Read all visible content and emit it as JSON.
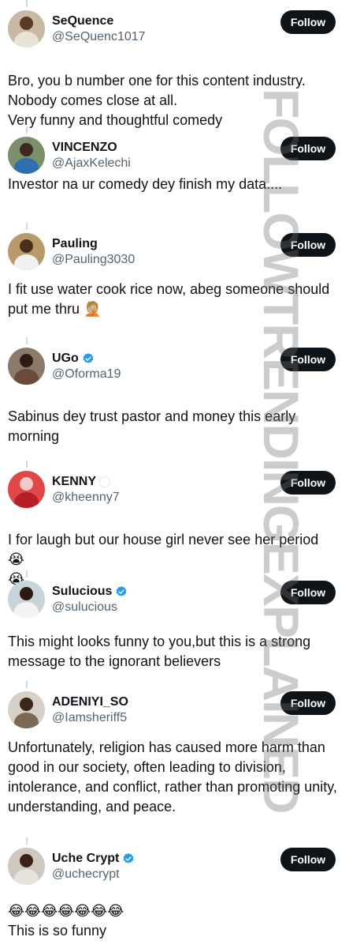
{
  "follow_label": "Follow",
  "verified_color": "#1d9bf0",
  "button_color": "#0f1419",
  "watermark": "FOLLOWTRENDINGEXPLAINED",
  "replies": [
    {
      "name": "SeQuence",
      "handle": "@SeQuenc1017",
      "verified": false,
      "badge": "",
      "text": "Bro, you b number one for this content industry.\nNobody comes close at all.\nVery funny and thoughtful comedy"
    },
    {
      "name": "VINCENZO",
      "handle": "@AjaxKelechi",
      "verified": false,
      "badge": "",
      "text": "Investor na ur comedy dey finish my data...."
    },
    {
      "name": "Pauling",
      "handle": "@Pauling3030",
      "verified": false,
      "badge": "",
      "text": "I fit use water cook rice now, abeg someone should put me thru 🤦🏼"
    },
    {
      "name": "UGo",
      "handle": "@Oforma19",
      "verified": true,
      "badge": "",
      "text": "Sabinus dey trust pastor and money this early morning"
    },
    {
      "name": "KENNY",
      "handle": "@kheenny7",
      "verified": false,
      "badge": "ring",
      "text": "I for laugh but our house girl never see her period 😭\n😭"
    },
    {
      "name": "Sulucious",
      "handle": "@sulucious",
      "verified": true,
      "badge": "",
      "text": "This might looks funny to you,but this is a strong message to the ignorant believers"
    },
    {
      "name": "ADENIYI_SO",
      "handle": "@Iamsheriff5",
      "verified": false,
      "badge": "",
      "text": "Unfortunately, religion has caused more harm than good in our society, often leading to division, intolerance, and conflict, rather than promoting unity, understanding, and peace."
    },
    {
      "name": "Uche Crypt",
      "handle": "@uchecrypt",
      "verified": true,
      "badge": "",
      "text": "😂😂😂😂😂😂😂\nThis is so funny"
    }
  ]
}
